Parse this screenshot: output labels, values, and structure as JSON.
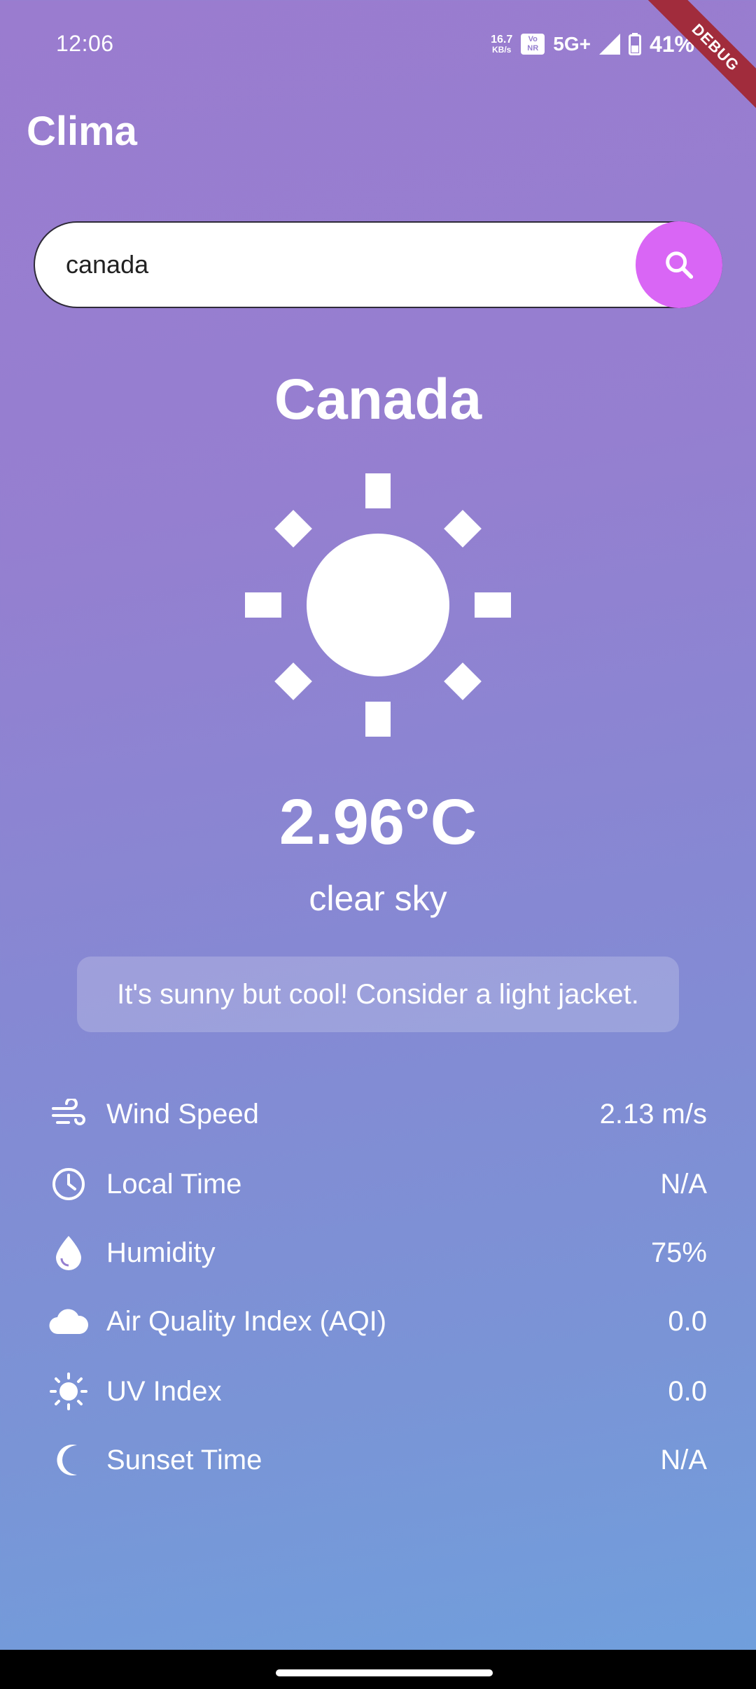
{
  "status_bar": {
    "time": "12:06",
    "net_speed_value": "16.7",
    "net_speed_unit": "KB/s",
    "vonr_top": "Vo",
    "vonr_bottom": "NR",
    "network": "5G+",
    "battery": "41%"
  },
  "debug_banner": "DEBUG",
  "app": {
    "title": "Clima"
  },
  "search": {
    "value": "canada",
    "placeholder": ""
  },
  "weather": {
    "city": "Canada",
    "icon": "sun-icon",
    "temperature": "2.96°C",
    "description": "clear sky",
    "advice": "It's sunny but cool! Consider a light jacket."
  },
  "details": [
    {
      "icon": "wind-icon",
      "label": "Wind Speed",
      "value": "2.13 m/s"
    },
    {
      "icon": "clock-icon",
      "label": "Local Time",
      "value": "N/A"
    },
    {
      "icon": "water-drop-icon",
      "label": "Humidity",
      "value": "75%"
    },
    {
      "icon": "cloud-icon",
      "label": "Air Quality Index (AQI)",
      "value": "0.0"
    },
    {
      "icon": "uv-sun-icon",
      "label": "UV Index",
      "value": "0.0"
    },
    {
      "icon": "moon-icon",
      "label": "Sunset Time",
      "value": "N/A"
    }
  ],
  "colors": {
    "accent": "#d966f5",
    "gradient_top": "#9a7ccf",
    "gradient_bottom": "#6fa0dd",
    "debug_ribbon": "#a12c3c"
  }
}
